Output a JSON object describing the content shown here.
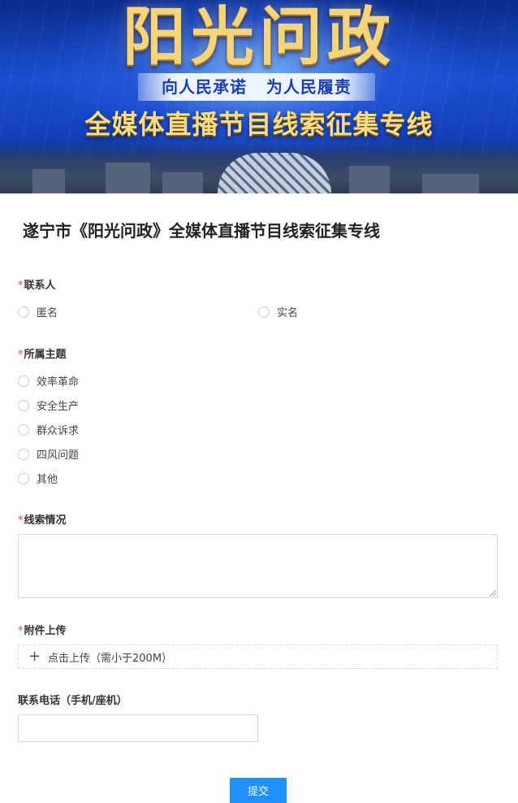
{
  "banner": {
    "title": "阳光问政",
    "slogan": "向人民承诺   为人民履责",
    "subtitle": "全媒体直播节目线索征集专线"
  },
  "form": {
    "page_title": "遂宁市《阳光问政》全媒体直播节目线索征集专线",
    "contact": {
      "label": "联系人",
      "required_mark": "*",
      "options": [
        "匿名",
        "实名"
      ]
    },
    "topic": {
      "label": "所属主题",
      "required_mark": "*",
      "options": [
        "效率革命",
        "安全生产",
        "群众诉求",
        "四风问题",
        "其他"
      ]
    },
    "clue": {
      "label": "线索情况",
      "required_mark": "*",
      "value": ""
    },
    "attachment": {
      "label": "附件上传",
      "required_mark": "*",
      "plus": "+",
      "button_text": "点击上传（需小于200M）"
    },
    "phone": {
      "label": "联系电话（手机/座机）",
      "value": ""
    },
    "submit_label": "提交"
  },
  "colors": {
    "accent": "#1e90ff",
    "required": "#e5484d"
  }
}
